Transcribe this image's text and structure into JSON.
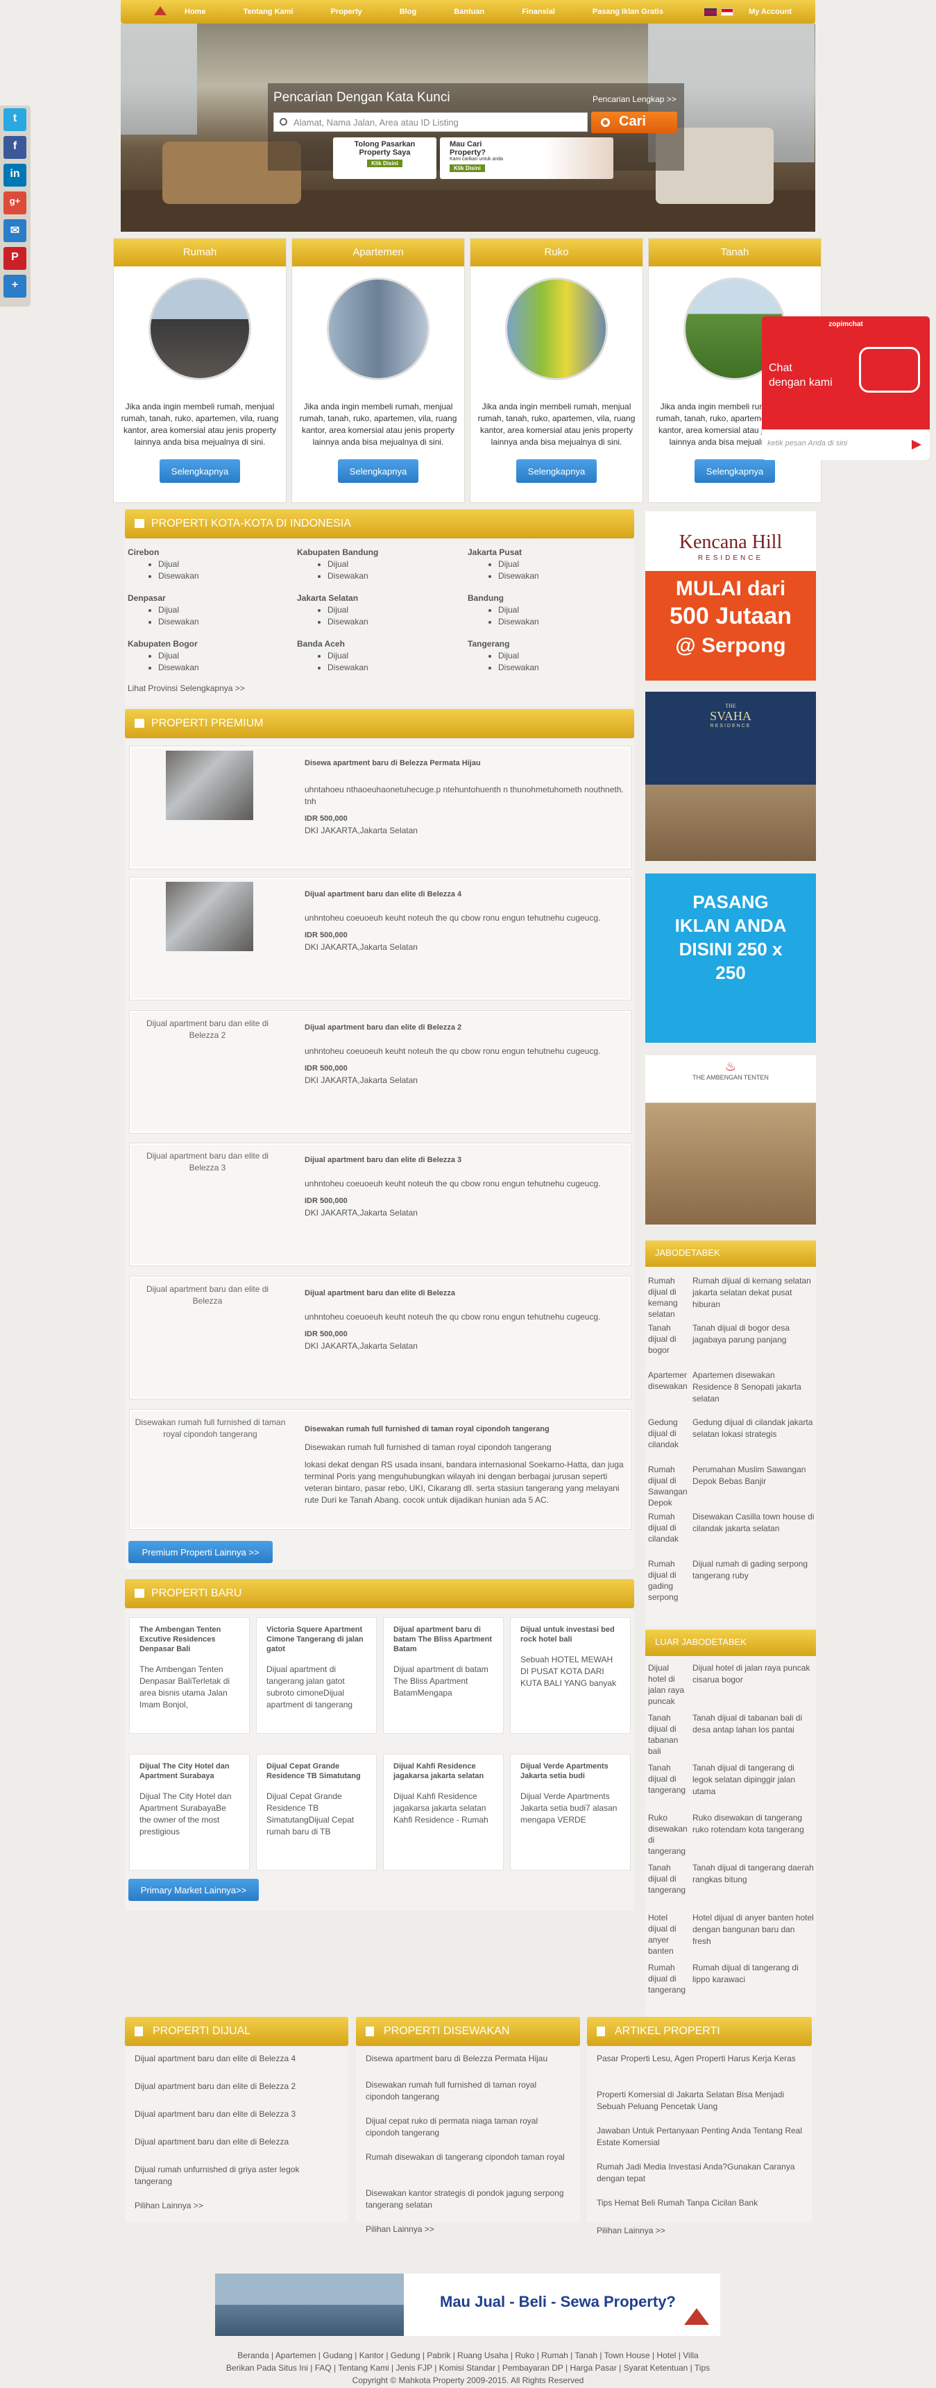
{
  "nav": {
    "items": [
      "Home",
      "Tentang Kami",
      "Property",
      "Blog",
      "Bantuan",
      "Finansial",
      "Pasang Iklan Gratis"
    ],
    "account": "My Account"
  },
  "search": {
    "title": "Pencarian Dengan Kata Kunci",
    "advanced": "Pencarian Lengkap >>",
    "placeholder": "Alamat, Nama Jalan, Area atau ID Listing",
    "button": "Cari"
  },
  "promos": [
    {
      "l1": "Tolong Pasarkan",
      "l2": "Property Saya",
      "btn": "Klik Disini"
    },
    {
      "l1": "Mau Cari",
      "l2": "Property?",
      "l3": "Kami carikan untuk anda",
      "btn": "Klik Disini"
    }
  ],
  "categories": [
    {
      "title": "Rumah",
      "desc": "Jika anda ingin membeli rumah, menjual rumah, tanah, ruko, apartemen, vila, ruang kantor, area komersial atau jenis property lainnya anda bisa mejualnya di sini.",
      "button": "Selengkapnya"
    },
    {
      "title": "Apartemen",
      "desc": "Jika anda ingin membeli rumah, menjual rumah, tanah, ruko, apartemen, vila, ruang kantor, area komersial atau jenis property lainnya anda bisa mejualnya di sini.",
      "button": "Selengkapnya"
    },
    {
      "title": "Ruko",
      "desc": "Jika anda ingin membeli rumah, menjual rumah, tanah, ruko, apartemen, vila, ruang kantor, area komersial atau jenis property lainnya anda bisa mejualnya di sini.",
      "button": "Selengkapnya"
    },
    {
      "title": "Tanah",
      "desc": "Jika anda ingin membeli rumah, menjual rumah, tanah, ruko, apartemen, vila, ruang kantor, area komersial atau jenis property lainnya anda bisa mejualnya di sini.",
      "button": "Selengkapnya"
    }
  ],
  "chat": {
    "brand": "zopimchat",
    "line1": "Chat",
    "line2": "dengan kami",
    "placeholder": "ketik pesan Anda di sini"
  },
  "cities": {
    "title": "PROPERTI KOTA-KOTA DI INDONESIA",
    "sub1": "Dijual",
    "sub2": "Disewakan",
    "list": [
      "Cirebon",
      "Kabupaten Bandung",
      "Jakarta Pusat",
      "Denpasar",
      "Jakarta Selatan",
      "Bandung",
      "Kabupaten Bogor",
      "Banda Aceh",
      "Tangerang"
    ],
    "more": "Lihat Provinsi Selengkapnya >>"
  },
  "premium": {
    "title": "PROPERTI PREMIUM",
    "items": [
      {
        "title": "Disewa apartment baru di Belezza Permata Hijau",
        "desc": "uhntahoeu nthaoeuhaonetuhecuge.p ntehuntohuenth n thunohmetuhometh nouthneth. tnh",
        "price": "IDR 500,000",
        "loc": "DKI JAKARTA,Jakarta Selatan"
      },
      {
        "title": "Dijual apartment baru dan elite di Belezza 4",
        "desc": "unhntoheu coeuoeuh keuht noteuh the qu cbow ronu engun tehutnehu cugeucg.",
        "price": "IDR 500,000",
        "loc": "DKI JAKARTA,Jakarta Selatan"
      },
      {
        "alt": "Dijual apartment baru dan elite di Belezza 2",
        "title": "Dijual apartment baru dan elite di Belezza 2",
        "desc": "unhntoheu coeuoeuh keuht noteuh the qu cbow ronu engun tehutnehu cugeucg.",
        "price": "IDR 500,000",
        "loc": "DKI JAKARTA,Jakarta Selatan"
      },
      {
        "alt": "Dijual apartment baru dan elite di Belezza 3",
        "title": "Dijual apartment baru dan elite di Belezza 3",
        "desc": "unhntoheu coeuoeuh keuht noteuh the qu cbow ronu engun tehutnehu cugeucg.",
        "price": "IDR 500,000",
        "loc": "DKI JAKARTA,Jakarta Selatan"
      },
      {
        "alt": "Dijual apartment baru dan elite di Belezza",
        "title": "Dijual apartment baru dan elite di Belezza",
        "desc": "unhntoheu coeuoeuh keuht noteuh the qu cbow ronu engun tehutnehu cugeucg.",
        "price": "IDR 500,000",
        "loc": "DKI JAKARTA,Jakarta Selatan"
      },
      {
        "alt": "Disewakan rumah full furnished di taman royal cipondoh tangerang",
        "title": "Disewakan rumah full furnished di taman royal cipondoh tangerang",
        "desc": "Disewakan rumah full furnished di taman royal cipondoh tangerang",
        "desc2": "lokasi dekat dengan RS usada insani, bandara internasional Soekarno-Hatta, dan juga terminal Poris yang menguhubungkan wilayah ini dengan berbagai jurusan seperti veteran bintaro, pasar rebo, UKI, Cikarang dll. serta stasiun tangerang yang melayani rute Duri ke Tanah Abang. cocok untuk dijadikan hunian ada 5 AC."
      }
    ],
    "more": "Premium Properti Lainnya >>"
  },
  "baru": {
    "title": "PROPERTI BARU",
    "items": [
      {
        "title": "The Ambengan Tenten Excutive Residences Denpasar Bali",
        "desc": "The Ambengan Tenten Denpasar BaliTerletak di area bisnis utama Jalan Imam Bonjol,"
      },
      {
        "title": "Victoria Squere Apartment Cimone Tangerang di jalan gatot",
        "desc": "Dijual apartment di tangerang jalan gatot subroto cimoneDijual apartment di tangerang"
      },
      {
        "title": "Dijual apartment baru di batam The Bliss Apartment Batam",
        "desc": "Dijual apartment di batam The Bliss Apartment BatamMengapa"
      },
      {
        "title": "Dijual untuk investasi bed rock hotel bali",
        "desc": "Sebuah HOTEL MEWAH DI PUSAT KOTA DARI KUTA BALI YANG banyak"
      },
      {
        "title": "Dijual The City Hotel dan Apartment Surabaya",
        "desc": "Dijual The City Hotel dan Apartment SurabayaBe the owner of the most prestigious"
      },
      {
        "title": "Dijual Cepat Grande Residence TB Simatutang",
        "desc": "Dijual Cepat Grande Residence TB SimatutangDijual Cepat rumah baru di TB"
      },
      {
        "title": "Dijual Kahfi Residence jagakarsa jakarta selatan",
        "desc": "Dijual Kahfi Residence jagakarsa jakarta selatan Kahfi Residence - Rumah"
      },
      {
        "title": "Dijual Verde Apartments Jakarta setia budi",
        "desc": "Dijual Verde Apartments Jakarta setia budi7 alasan mengapa VERDE"
      }
    ],
    "more": "Primary Market Lainnya>>"
  },
  "ads": {
    "kencana1": "Kencana Hill",
    "kencana2": "RESIDENCE",
    "kencana3": "MULAI dari",
    "kencana4": "500 Jutaan",
    "kencana5": "@ Serpong",
    "svaha1": "THE",
    "svaha2": "SVAHA",
    "svaha3": "RESIDENCE",
    "pasang": "PASANG IKLAN ANDA DISINI 250 x 250",
    "ambengan": "THE AMBENGAN TENTEN"
  },
  "jabo": {
    "title": "JABODETABEK",
    "left": [
      "Rumah dijual di kemang selatan",
      "Tanah dijual di bogor",
      "Apartemen disewakan",
      "Gedung dijual di cilandak",
      "Rumah dijual di Sawangan Depok",
      "Rumah dijual di cilandak",
      "Rumah dijual di gading serpong"
    ],
    "right": [
      "Rumah dijual di kemang selatan jakarta selatan dekat pusat hiburan",
      "Tanah dijual di bogor desa jagabaya parung panjang",
      "Apartemen disewakan Residence 8 Senopati jakarta selatan",
      "Gedung dijual di cilandak jakarta selatan lokasi strategis",
      "Perumahan Muslim Sawangan Depok Bebas Banjir",
      "Disewakan Casilla town house di cilandak jakarta selatan",
      "Dijual rumah di gading serpong tangerang ruby"
    ]
  },
  "luar": {
    "title": "LUAR JABODETABEK",
    "left": [
      "Dijual hotel di jalan raya puncak",
      "Tanah dijual di tabanan bali",
      "Tanah dijual di tangerang",
      "Ruko disewakan di tangerang",
      "Tanah dijual di tangerang",
      "Hotel dijual di anyer banten",
      "Rumah dijual di tangerang"
    ],
    "right": [
      "Dijual hotel di jalan raya puncak cisarua bogor",
      "Tanah dijual di tabanan bali di desa antap lahan los pantai",
      "Tanah dijual di tangerang di legok selatan dipinggir jalan utama",
      "Ruko disewakan di tangerang ruko rotendam kota tangerang",
      "Tanah dijual di tangerang daerah rangkas bitung",
      "Hotel dijual di anyer banten hotel dengan bangunan baru dan fresh",
      "Rumah dijual di tangerang di lippo karawaci"
    ]
  },
  "dijual": {
    "title": "PROPERTI DIJUAL",
    "items": [
      "Dijual apartment baru dan elite di Belezza 4",
      "Dijual apartment baru dan elite di Belezza 2",
      "Dijual apartment baru dan elite di Belezza 3",
      "Dijual apartment baru dan elite di Belezza",
      "Dijual rumah unfurnished di griya aster legok tangerang"
    ],
    "more": "Pilihan Lainnya >>"
  },
  "disewakan": {
    "title": "PROPERTI DISEWAKAN",
    "items": [
      "Disewa apartment baru di Belezza Permata Hijau",
      "Disewakan rumah full furnished di taman royal cipondoh tangerang",
      "Dijual cepat ruko di permata niaga taman royal cipondoh tangerang",
      "Rumah disewakan di tangerang cipondoh taman royal",
      "Disewakan kantor strategis di pondok jagung serpong tangerang selatan"
    ],
    "more": "Pilihan Lainnya >>"
  },
  "artikel": {
    "title": "ARTIKEL PROPERTI",
    "items": [
      "Pasar Properti Lesu, Agen Properti Harus Kerja Keras",
      "Properti Komersial di Jakarta Selatan Bisa Menjadi Sebuah Peluang Pencetak Uang",
      "Jawaban Untuk Pertanyaan Penting Anda Tentang Real Estate Komersial",
      "Rumah Jadi Media Investasi Anda?Gunakan Caranya dengan tepat",
      "Tips Hemat Beli Rumah Tanpa Cicilan Bank"
    ],
    "more": "Pilihan Lainnya >>"
  },
  "footer": {
    "banner": "Mau Jual - Beli - Sewa Property?",
    "links1": "Beranda | Apartemen | Gudang | Kantor | Gedung | Pabrik | Ruang Usaha | Ruko | Rumah | Tanah | Town House | Hotel | Villa",
    "links2": "Berikan Pada Situs Ini | FAQ | Tentang Kami | Jenis FJP | Komisi Standar | Pembayaran DP | Harga Pasar | Syarat Ketentuan | Tips",
    "copy": "Copyright © Mahkota Property 2009-2015. All Rights Reserved"
  }
}
